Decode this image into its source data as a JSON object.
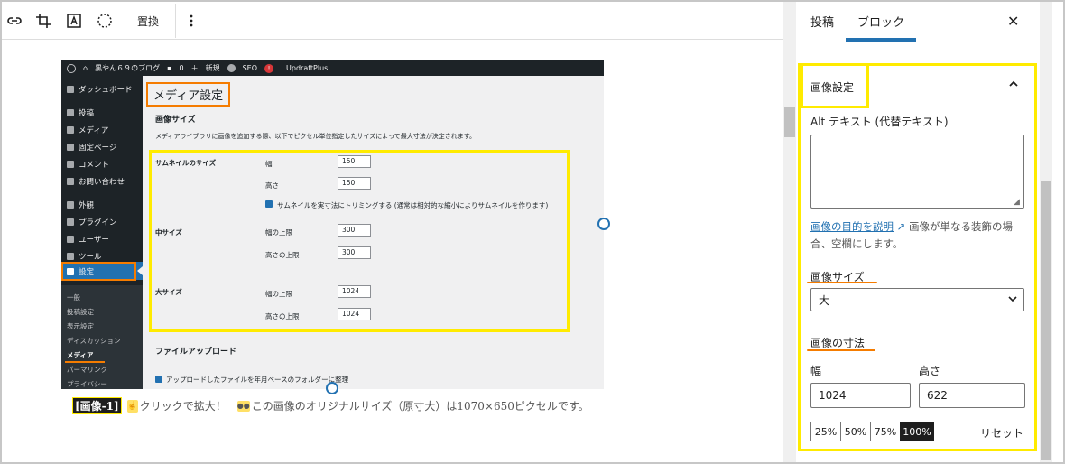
{
  "toolbar": {
    "replace_label": "置換"
  },
  "wp_screenshot": {
    "admin_bar": {
      "site_name": "黒やん６９のブログ",
      "comments_count": "0",
      "new_label": "新規",
      "seo_label": "SEO",
      "seo_badge": "!",
      "plugin_label": "UpdraftPlus"
    },
    "sidebar": {
      "items": [
        {
          "label": "ダッシュボード"
        },
        {
          "label": "投稿"
        },
        {
          "label": "メディア"
        },
        {
          "label": "固定ページ"
        },
        {
          "label": "コメント"
        },
        {
          "label": "お問い合わせ"
        },
        {
          "label": "外観"
        },
        {
          "label": "プラグイン"
        },
        {
          "label": "ユーザー"
        },
        {
          "label": "ツール"
        },
        {
          "label": "設定"
        }
      ],
      "sub_items": [
        {
          "label": "一般"
        },
        {
          "label": "投稿設定"
        },
        {
          "label": "表示設定"
        },
        {
          "label": "ディスカッション"
        },
        {
          "label": "メディア"
        },
        {
          "label": "パーマリンク"
        },
        {
          "label": "プライバシー"
        }
      ]
    },
    "page_title": "メディア設定",
    "section_title": "画像サイズ",
    "description": "メディアライブラリに画像を追加する際、以下でピクセル単位指定したサイズによって最大寸法が決定されます。",
    "thumbnail": {
      "label": "サムネイルのサイズ",
      "width_label": "幅",
      "width_value": "150",
      "height_label": "高さ",
      "height_value": "150",
      "crop_label": "サムネイルを実寸法にトリミングする (通常は相対的な縮小によりサムネイルを作ります)"
    },
    "medium": {
      "label": "中サイズ",
      "width_label": "幅の上限",
      "width_value": "300",
      "height_label": "高さの上限",
      "height_value": "300"
    },
    "large": {
      "label": "大サイズ",
      "width_label": "幅の上限",
      "width_value": "1024",
      "height_label": "高さの上限",
      "height_value": "1024"
    },
    "upload_title": "ファイルアップロード",
    "upload_option": "アップロードしたファイルを年月ベースのフォルダーに整理"
  },
  "caption": {
    "tag": "[画像-1]",
    "text1": "クリックで拡大！",
    "text2": "この画像のオリジナルサイズ（原寸大）は1070×650ピクセルです。"
  },
  "inspector": {
    "tabs": [
      {
        "label": "投稿"
      },
      {
        "label": "ブロック"
      }
    ],
    "panel_title": "画像設定",
    "alt_label": "Alt テキスト (代替テキスト)",
    "alt_value": "",
    "help_link": "画像の目的を説明",
    "help_text": "画像が単なる装飾の場合、空欄にします。",
    "size_label": "画像サイズ",
    "size_value": "大",
    "dimensions_label": "画像の寸法",
    "width_label": "幅",
    "width_value": "1024",
    "height_label": "高さ",
    "height_value": "622",
    "percent_buttons": [
      "25%",
      "50%",
      "75%",
      "100%"
    ],
    "active_percent": "100%",
    "reset_label": "リセット"
  },
  "colors": {
    "highlight_yellow": "#ffeb00",
    "underline_orange": "#f57c00",
    "wp_admin_dark": "#1d2327",
    "wp_active_blue": "#2271b1"
  }
}
